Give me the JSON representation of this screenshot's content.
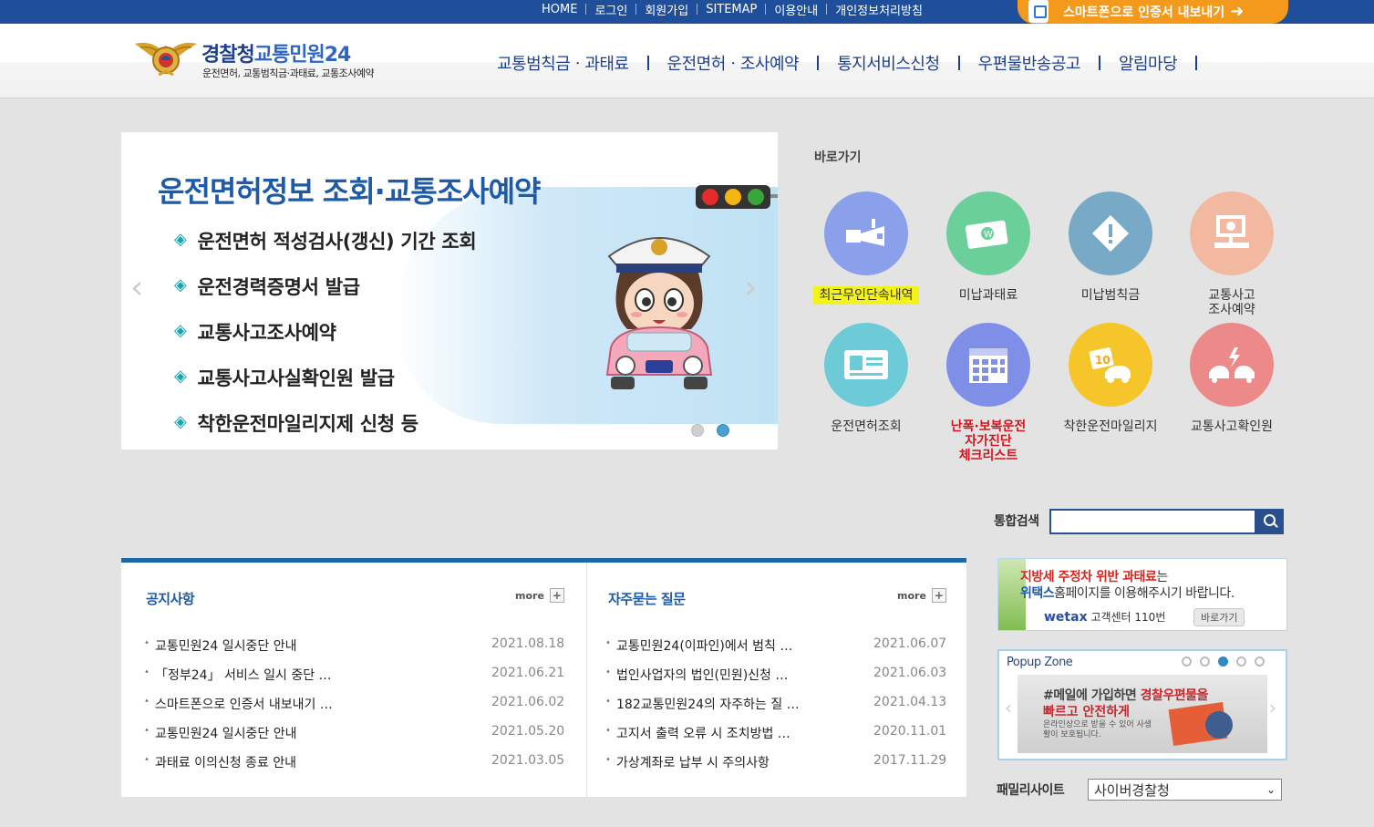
{
  "topbar": {
    "links": [
      "HOME",
      "로그인",
      "회원가입",
      "SITEMAP",
      "이용안내",
      "개인정보처리방침"
    ],
    "smart_btn": "스마트폰으로 인증서 내보내기"
  },
  "logo": {
    "name_a": "경찰청",
    "name_b": "교통민원24",
    "sub": "운전면허, 교통범칙금·과태료, 교통조사예약"
  },
  "gnb": [
    "교통범칙금ㆍ과태료",
    "운전면허ㆍ조사예약",
    "통지서비스신청",
    "우편물반송공고",
    "알림마당"
  ],
  "banner": {
    "title": "운전면허정보 조회·교통조사예약",
    "items": [
      "운전면허 적성검사(갱신) 기간 조회",
      "운전경력증명서 발급",
      "교통사고조사예약",
      "교통사고사실확인원 발급",
      "착한운전마일리지제 신청 등"
    ],
    "bullet": "◈",
    "active_slide": 2,
    "slide_count": 2
  },
  "quick": {
    "title": "바로가기",
    "items": [
      {
        "label": "최근무인단속내역",
        "icon": "camera-icon",
        "color": "#8aa0ea"
      },
      {
        "label": "미납과태료",
        "icon": "money-icon",
        "color": "#6bcf9a"
      },
      {
        "label": "미납범칙금",
        "icon": "warning-icon",
        "color": "#78a9c6"
      },
      {
        "label": "교통사고\n조사예약",
        "icon": "computer-icon",
        "color": "#f3b9a0"
      },
      {
        "label": "운전면허조회",
        "icon": "license-card-icon",
        "color": "#6ccbd6"
      },
      {
        "label": "난폭·보복운전\n자가진단\n체크리스트",
        "icon": "calendar-check-icon",
        "color": "#7f8fe8"
      },
      {
        "label": "착한운전마일리지",
        "icon": "mileage-car-icon",
        "color": "#f5c52a"
      },
      {
        "label": "교통사고확인원",
        "icon": "car-crash-icon",
        "color": "#ec8a8a"
      }
    ]
  },
  "search": {
    "label": "통합검색",
    "value": ""
  },
  "notice": {
    "title": "공지사항",
    "more": "more",
    "items": [
      {
        "text": "교통민원24 일시중단 안내",
        "date": "2021.08.18"
      },
      {
        "text": "「정부24」 서비스 일시 중단 …",
        "date": "2021.06.21"
      },
      {
        "text": "스마트폰으로 인증서 내보내기 …",
        "date": "2021.06.02"
      },
      {
        "text": "교통민원24 일시중단 안내",
        "date": "2021.05.20"
      },
      {
        "text": "과태료 이의신청 종료 안내",
        "date": "2021.03.05"
      }
    ]
  },
  "faq": {
    "title": "자주묻는 질문",
    "more": "more",
    "items": [
      {
        "text": "교통민원24(이파인)에서 범칙 …",
        "date": "2021.06.07"
      },
      {
        "text": "법인사업자의 법인(민원)신청 …",
        "date": "2021.06.03"
      },
      {
        "text": "182교통민원24의 자주하는 질 …",
        "date": "2021.04.13"
      },
      {
        "text": "고지서 출력 오류 시 조치방법 …",
        "date": "2020.11.01"
      },
      {
        "text": "가상계좌로 납부 시 주의사항",
        "date": "2017.11.29"
      }
    ]
  },
  "ad": {
    "l1_red": "지방세 주정차 위반 과태료",
    "l1_rest": "는",
    "l2_bold": "위택스",
    "l2_rest": "홈페이지를 이용해주시기 바랍니다.",
    "brand": "wetax",
    "center": "고객센터 110번",
    "go": "바로가기"
  },
  "popup": {
    "title": "Popup Zone",
    "active": 3,
    "count": 5,
    "t1a": "#메일에 가입하면 ",
    "t1b": "경찰우편물을",
    "t2": "빠르고 안전하게",
    "t3": "온라인상으로 받을 수 있어 사생활이 보호됩니다."
  },
  "family": {
    "label": "패밀리사이트",
    "selected": "사이버경찰청"
  }
}
